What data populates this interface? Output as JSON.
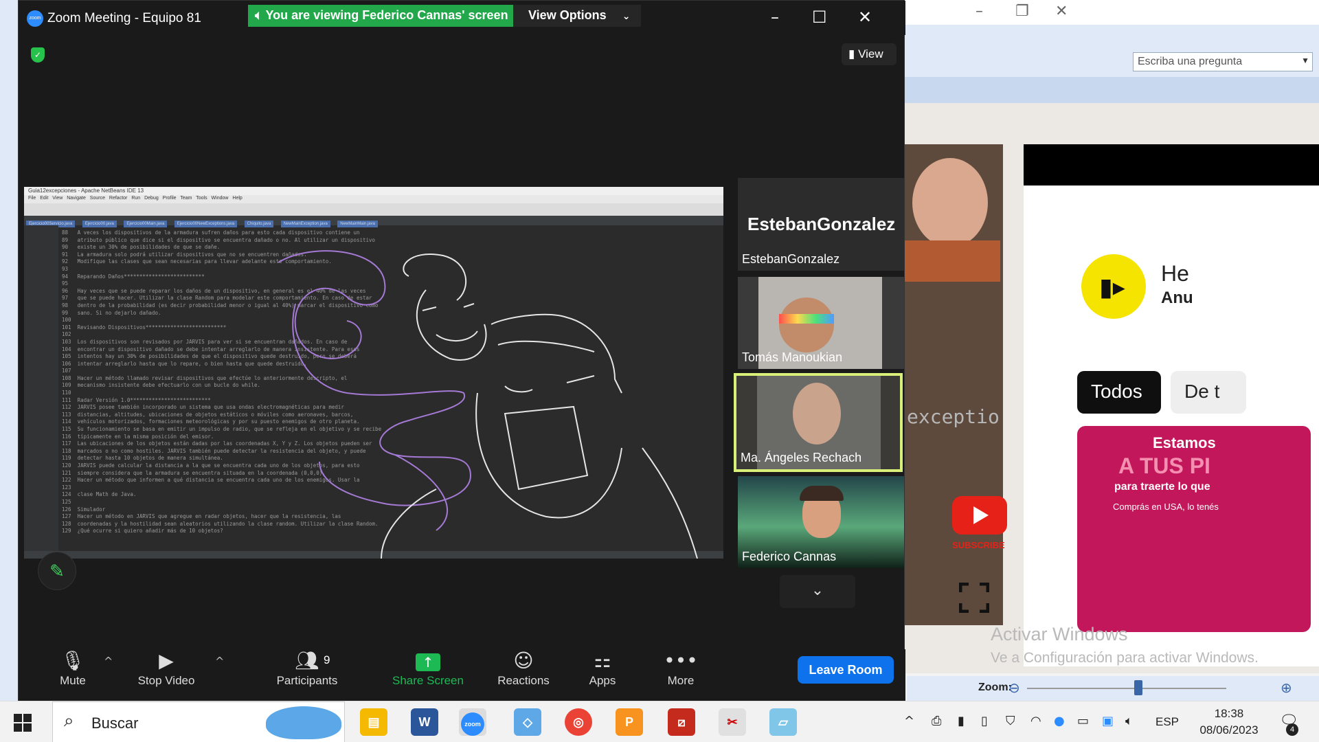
{
  "zoom": {
    "title": "Zoom Meeting - Equipo 81",
    "logo_text": "zoom",
    "banner": "You are viewing Federico Cannas' screen",
    "view_options": "View Options",
    "view_button": "View",
    "leave_button": "Leave Room"
  },
  "shared_screen": {
    "ide_title": "Guia12excepciones - Apache NetBeans IDE 13",
    "ide_menu": "File Edit View Navigate Source Refactor Run Debug Profile Team Tools Window Help",
    "ide_tabs": [
      "Ejercicio00Servicio.java",
      "Ejercicio00.java",
      "Ejercicio00Main.java",
      "Ejercicio00NewExceptions.java",
      "Chiquito.java",
      "NewMainException.java",
      "NewMainMain.java"
    ],
    "code": "88   A veces los dispositivos de la armadura sufren daños para esto cada dispositivo contiene un\n89   atributo público que dice si el dispositivo se encuentra dañado o no. Al utilizar un dispositivo\n90   existe un 30% de posibilidades de que se dañe.\n91   La armadura solo podrá utilizar dispositivos que no se encuentren dañados.\n92   Modifique las clases que sean necesarias para llevar adelante este comportamiento.\n93\n94   Reparando Daños**************************\n95\n96   Hay veces que se puede reparar los daños de un dispositivo, en general es el 40% de las veces\n97   que se puede hacer. Utilizar la clase Random para modelar este comportamiento. En caso de estar\n98   dentro de la probabilidad (es decir probabilidad menor o igual al 40%) marcar el dispositivo como\n99   sano. Si no dejarlo dañado.\n100\n101  Revisando Dispositivos**************************\n102\n103  Los dispositivos son revisados por JARVIS para ver si se encuentran dañados. En caso de\n104  encontrar un dispositivo dañado se debe intentar arreglarlo de manera insistente. Para esos\n105  intentos hay un 30% de posibilidades de que el dispositivo quede destruido, pero se deberá\n106  intentar arreglarlo hasta que lo repare, o bien hasta que quede destruido.\n107\n108  Hacer un método llamado revisar dispositivos que efectúe lo anteriormente descripto, el\n109  mecanismo insistente debe efectuarlo con un bucle do while.\n110\n111  Radar Versión 1.0**************************\n112  JARVIS posee también incorporado un sistema que usa ondas electromagnéticas para medir\n113  distancias, altitudes, ubicaciones de objetos estáticos o móviles como aeronaves, barcos,\n114  vehículos motorizados, formaciones meteorológicas y por su puesto enemigos de otro planeta.\n115  Su funcionamiento se basa en emitir un impulso de radio, que se refleja en el objetivo y se recibe\n116  típicamente en la misma posición del emisor.\n117  Las ubicaciones de los objetos están dadas por las coordenadas X, Y y Z. Los objetos pueden ser\n118  marcados o no como hostiles. JARVIS también puede detectar la resistencia del objeto, y puede\n119  detectar hasta 10 objetos de manera simultánea.\n120  JARVIS puede calcular la distancia a la que se encuentra cada uno de los objetos, para esto\n121  siempre considera que la armadura se encuentra situada en la coordenada (0,0,0).\n122  Hacer un método que informen a qué distancia se encuentra cada uno de los enemigos. Usar la\n123\n124  clase Math de Java.\n125\n126  Simulador\n127  Hacer un método en JARVIS que agregue en radar objetos, hacer que la resistencia, las\n128  coordenadas y la hostilidad sean aleatorios utilizando la clase random. Utilizar la clase Random.\n129  ¿Qué ocurre si quiero añadir más de 10 objetos?"
  },
  "participants": [
    {
      "name": "EstebanGonzalez",
      "display": "EstebanGonzalez",
      "video": false
    },
    {
      "name": "Tomás Manoukian",
      "video": true
    },
    {
      "name": "Ma. Ángeles Rechach",
      "video": true,
      "active_speaker": true
    },
    {
      "name": "Federico Cannas",
      "video": true
    }
  ],
  "toolbar": {
    "mute": "Mute",
    "stop_video": "Stop Video",
    "participants": "Participants",
    "participants_count": "9",
    "share_screen": "Share Screen",
    "reactions": "Reactions",
    "apps": "Apps",
    "more": "More"
  },
  "background_app": {
    "search_placeholder": "Escriba una pregunta",
    "video_text": "exceptio",
    "page_he": "He",
    "page_anu": "Anu",
    "chip_todos": "Todos",
    "chip_de": "De t",
    "promo_line1": "Estamos",
    "promo_line2": "A TUS PI",
    "promo_line3": "para traerte lo que",
    "promo_line4": "Comprás en USA, lo tenés",
    "subscribe": "SUBSCRIBE",
    "activate_title": "Activar Windows",
    "activate_sub": "Ve a Configuración para activar Windows.",
    "zoom_label": "Zoom:"
  },
  "taskbar": {
    "search_text": "Buscar",
    "language": "ESP",
    "time": "18:38",
    "date": "08/06/2023",
    "notifications": "4"
  },
  "colors": {
    "zoom_green": "#22a84a",
    "zoom_blue": "#0e72ed",
    "active_border": "#d8f07a",
    "doodle_white": "#e6e6e6",
    "doodle_purple": "#a57ad6"
  }
}
